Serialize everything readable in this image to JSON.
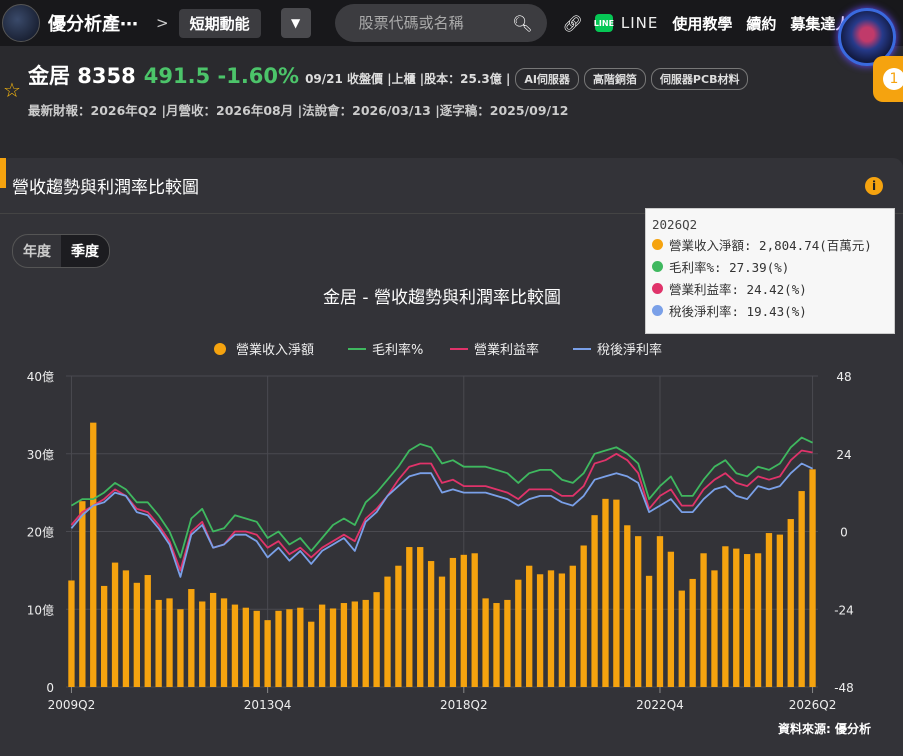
{
  "nav": {
    "brand": "優分析產⋯",
    "crumb_sep": ">",
    "crumb": "短期動能",
    "search_placeholder": "股票代碼或名稱",
    "line_label": "LINE",
    "links": [
      "使用教學",
      "續約",
      "募集達人"
    ],
    "badge": "1"
  },
  "stock": {
    "name": "金居 8358",
    "price": "491.5 -1.60%",
    "meta": "09/21 收盤價 |上櫃 |股本：25.3億 |",
    "tags": [
      "AI伺服器",
      "高階銅箔",
      "伺服器PCB材料"
    ],
    "fin_line": "最新財報：2026年Q2 |月營收：2026年08月 |法說會：2026/03/13 |逐字稿：2025/09/12"
  },
  "card": {
    "title": "營收趨勢與利潤率比較圖",
    "toggle": [
      "年度",
      "季度"
    ],
    "source": "資料來源: 優分析"
  },
  "tooltip": {
    "period": "2026Q2",
    "rows": [
      {
        "label": "營業收入淨額: 2,804.74(百萬元)",
        "color": "#f5a30f"
      },
      {
        "label": "毛利率%: 27.39(%)",
        "color": "#3fb85f"
      },
      {
        "label": "營業利益率: 24.42(%)",
        "color": "#e0336a"
      },
      {
        "label": "稅後淨利率: 19.43(%)",
        "color": "#7aa0e8"
      }
    ]
  },
  "chart_data": {
    "type": "bar",
    "title": "金居 - 營收趨勢與利潤率比較圖",
    "legend_position": "top",
    "series": [
      {
        "name": "營業收入淨額",
        "kind": "bar",
        "axis": "left",
        "color": "#f5a30f"
      },
      {
        "name": "毛利率%",
        "kind": "line",
        "axis": "right",
        "color": "#3fb85f"
      },
      {
        "name": "營業利益率",
        "kind": "line",
        "axis": "right",
        "color": "#e0336a"
      },
      {
        "name": "稅後淨利率",
        "kind": "line",
        "axis": "right",
        "color": "#7aa0e8"
      }
    ],
    "x_ticks": [
      "2009Q2",
      "2013Q4",
      "2018Q2",
      "2022Q4",
      "2026Q2"
    ],
    "y_left": {
      "ticks": [
        "0",
        "10億",
        "20億",
        "30億",
        "40億"
      ],
      "range": [
        0,
        40
      ]
    },
    "y_right": {
      "ticks": [
        "-48",
        "-24",
        "0",
        "24",
        "48"
      ],
      "range": [
        -48,
        48
      ]
    },
    "periods": [
      "2009Q2",
      "2009Q3",
      "2009Q4",
      "2010Q1",
      "2010Q2",
      "2010Q3",
      "2010Q4",
      "2011Q1",
      "2011Q2",
      "2011Q3",
      "2011Q4",
      "2012Q1",
      "2012Q2",
      "2012Q3",
      "2012Q4",
      "2013Q1",
      "2013Q2",
      "2013Q3",
      "2013Q4",
      "2014Q1",
      "2014Q2",
      "2014Q3",
      "2014Q4",
      "2015Q1",
      "2015Q2",
      "2015Q3",
      "2015Q4",
      "2016Q1",
      "2016Q2",
      "2016Q3",
      "2016Q4",
      "2017Q1",
      "2017Q2",
      "2017Q3",
      "2017Q4",
      "2018Q1",
      "2018Q2",
      "2018Q3",
      "2018Q4",
      "2019Q1",
      "2019Q2",
      "2019Q3",
      "2019Q4",
      "2020Q1",
      "2020Q2",
      "2020Q3",
      "2020Q4",
      "2021Q1",
      "2021Q2",
      "2021Q3",
      "2021Q4",
      "2022Q1",
      "2022Q2",
      "2022Q3",
      "2022Q4",
      "2023Q1",
      "2023Q2",
      "2023Q3",
      "2023Q4",
      "2024Q1",
      "2024Q2",
      "2024Q3",
      "2024Q4",
      "2025Q1",
      "2025Q2",
      "2025Q3",
      "2025Q4",
      "2026Q1",
      "2026Q2"
    ],
    "revenue": [
      13.7,
      23.9,
      34.0,
      13.0,
      16.0,
      15.0,
      13.4,
      14.4,
      11.2,
      11.4,
      10.0,
      12.6,
      11.0,
      12.1,
      11.4,
      10.6,
      10.2,
      9.8,
      8.6,
      9.8,
      10.0,
      10.2,
      8.4,
      10.6,
      10.1,
      10.8,
      11.0,
      11.2,
      12.2,
      14.2,
      15.6,
      18.0,
      18.0,
      16.2,
      14.2,
      16.6,
      17.0,
      17.2,
      11.4,
      10.8,
      11.2,
      13.8,
      15.6,
      14.5,
      15.0,
      14.6,
      15.6,
      18.2,
      22.1,
      24.2,
      24.1,
      20.8,
      19.4,
      14.3,
      19.4,
      17.4,
      12.4,
      13.9,
      17.2,
      15.0,
      18.1,
      17.8,
      17.1,
      17.2,
      19.8,
      19.6,
      21.6,
      25.2,
      28.0
    ],
    "gross_margin": [
      8.0,
      10.0,
      10.0,
      12.0,
      15.0,
      13.0,
      9.0,
      9.0,
      5.0,
      0.0,
      -8.0,
      4.0,
      7.0,
      0.0,
      1.0,
      5.0,
      4.0,
      3.0,
      -2.0,
      0.0,
      -4.0,
      -2.0,
      -6.0,
      -2.0,
      2.0,
      4.0,
      2.0,
      9.0,
      12.0,
      16.0,
      20.0,
      25.0,
      27.0,
      26.0,
      21.0,
      22.0,
      20.0,
      20.0,
      20.0,
      19.0,
      18.0,
      15.0,
      18.0,
      19.0,
      19.0,
      16.0,
      15.0,
      18.0,
      24.0,
      25.0,
      26.0,
      24.0,
      21.0,
      10.0,
      14.0,
      17.0,
      11.0,
      11.0,
      16.0,
      20.0,
      22.0,
      18.0,
      17.0,
      20.0,
      19.0,
      21.0,
      26.0,
      29.0,
      27.4
    ],
    "op_margin": [
      2.0,
      6.0,
      8.0,
      10.0,
      13.0,
      11.0,
      7.0,
      6.0,
      2.0,
      -3.0,
      -12.0,
      0.0,
      3.0,
      -5.0,
      -4.0,
      0.0,
      0.0,
      -1.0,
      -5.0,
      -3.0,
      -7.0,
      -5.0,
      -8.0,
      -5.0,
      -3.0,
      -1.0,
      -3.0,
      4.0,
      7.0,
      11.0,
      16.0,
      20.0,
      21.0,
      21.0,
      15.0,
      16.0,
      14.0,
      14.0,
      14.0,
      13.0,
      12.0,
      10.0,
      13.0,
      13.0,
      13.0,
      11.0,
      11.0,
      14.0,
      21.0,
      22.0,
      24.0,
      22.0,
      18.0,
      7.0,
      11.0,
      13.0,
      8.0,
      8.0,
      13.0,
      16.0,
      18.0,
      15.0,
      14.0,
      17.0,
      16.0,
      17.0,
      22.0,
      25.0,
      24.4
    ],
    "net_margin": [
      1.0,
      5.0,
      8.0,
      9.0,
      12.0,
      11.0,
      6.0,
      5.0,
      1.0,
      -4.0,
      -14.0,
      -1.0,
      2.0,
      -5.0,
      -4.0,
      -1.0,
      -1.0,
      -3.0,
      -8.0,
      -5.0,
      -9.0,
      -6.0,
      -10.0,
      -6.0,
      -4.0,
      -2.0,
      -6.0,
      3.0,
      6.0,
      11.0,
      14.0,
      17.0,
      18.0,
      18.0,
      12.0,
      13.0,
      12.0,
      12.0,
      12.0,
      11.0,
      10.0,
      8.0,
      10.0,
      11.0,
      11.0,
      9.0,
      8.0,
      11.0,
      16.0,
      17.0,
      18.0,
      17.0,
      15.0,
      6.0,
      8.0,
      10.0,
      6.0,
      6.0,
      10.0,
      13.0,
      14.0,
      11.0,
      10.0,
      14.0,
      13.0,
      14.0,
      18.0,
      21.0,
      19.4
    ]
  }
}
